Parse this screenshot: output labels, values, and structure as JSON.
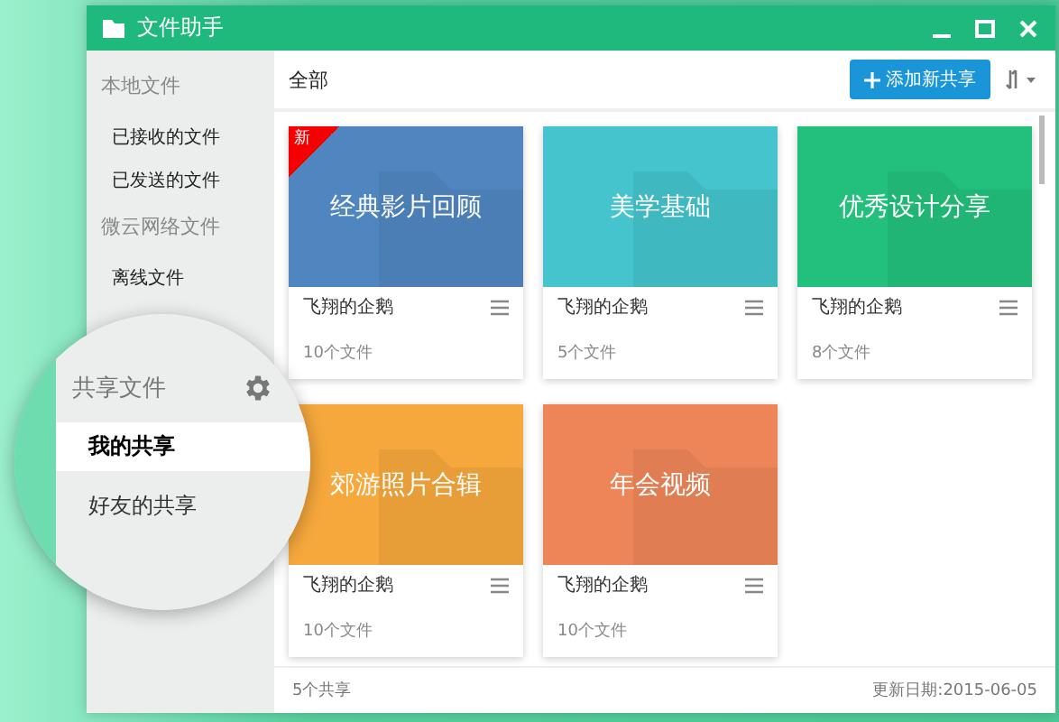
{
  "window": {
    "title": "文件助手"
  },
  "sidebar": {
    "sections": [
      {
        "title": "本地文件",
        "items": [
          {
            "label": "已接收的文件",
            "selected": false
          },
          {
            "label": "已发送的文件",
            "selected": false
          }
        ]
      },
      {
        "title": "微云网络文件",
        "items": [
          {
            "label": "离线文件",
            "selected": false
          }
        ]
      }
    ]
  },
  "magnifier": {
    "title": "共享文件",
    "items": [
      {
        "label": "我的共享",
        "selected": true
      },
      {
        "label": "好友的共享",
        "selected": false
      }
    ]
  },
  "toolbar": {
    "filter": "全部",
    "add_button": "添加新共享"
  },
  "cards": [
    {
      "title": "经典影片回顾",
      "owner": "飞翔的企鹅",
      "count": "10个文件",
      "color": "#4f86c0",
      "badge": "新"
    },
    {
      "title": "美学基础",
      "owner": "飞翔的企鹅",
      "count": "5个文件",
      "color": "#45c4cd"
    },
    {
      "title": "优秀设计分享",
      "owner": "飞翔的企鹅",
      "count": "8个文件",
      "color": "#23c07d"
    },
    {
      "title": "郊游照片合辑",
      "owner": "飞翔的企鹅",
      "count": "10个文件",
      "color": "#f6a83c"
    },
    {
      "title": "年会视频",
      "owner": "飞翔的企鹅",
      "count": "10个文件",
      "color": "#ee8558"
    }
  ],
  "status_bar": {
    "total": "5个共享",
    "updated": "更新日期:2015-06-05"
  }
}
